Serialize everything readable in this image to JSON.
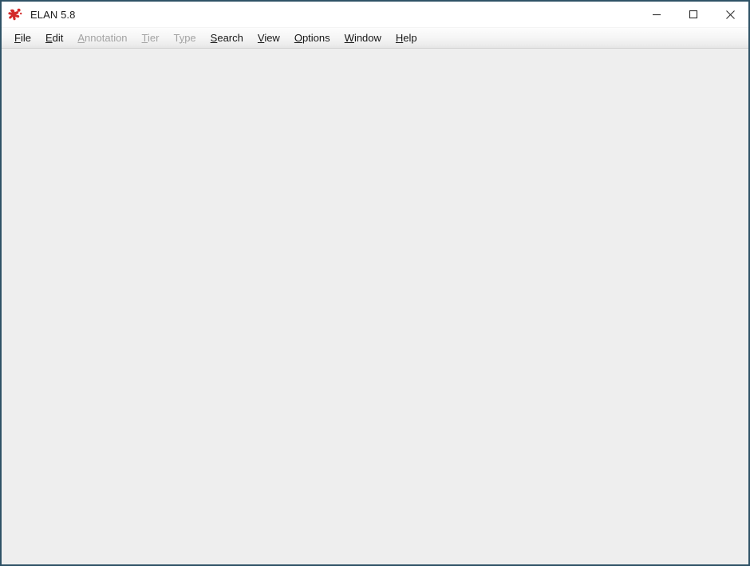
{
  "window": {
    "title": "ELAN 5.8",
    "app_icon": "elan-logo-icon",
    "border_color": "#2e5266",
    "titlebar_color": "#ffffff",
    "content_color": "#eeeeee",
    "logo_color": "#d32b2b"
  },
  "titlebar": {
    "minimize_label": "–",
    "maximize_label": "□",
    "close_label": "✕",
    "minimize_name": "minimize-icon",
    "maximize_name": "maximize-icon",
    "close_name": "close-icon"
  },
  "menubar": {
    "items": [
      {
        "label": "File",
        "mnemonic": "F",
        "mnemonic_index": 0,
        "enabled": true
      },
      {
        "label": "Edit",
        "mnemonic": "E",
        "mnemonic_index": 0,
        "enabled": true
      },
      {
        "label": "Annotation",
        "mnemonic": "A",
        "mnemonic_index": 0,
        "enabled": false
      },
      {
        "label": "Tier",
        "mnemonic": "T",
        "mnemonic_index": 0,
        "enabled": false
      },
      {
        "label": "Type",
        "mnemonic": "y",
        "mnemonic_index": 1,
        "enabled": false
      },
      {
        "label": "Search",
        "mnemonic": "S",
        "mnemonic_index": 0,
        "enabled": true
      },
      {
        "label": "View",
        "mnemonic": "V",
        "mnemonic_index": 0,
        "enabled": true
      },
      {
        "label": "Options",
        "mnemonic": "O",
        "mnemonic_index": 0,
        "enabled": true
      },
      {
        "label": "Window",
        "mnemonic": "W",
        "mnemonic_index": 0,
        "enabled": true
      },
      {
        "label": "Help",
        "mnemonic": "H",
        "mnemonic_index": 0,
        "enabled": true
      }
    ]
  },
  "content": {
    "text": ""
  }
}
